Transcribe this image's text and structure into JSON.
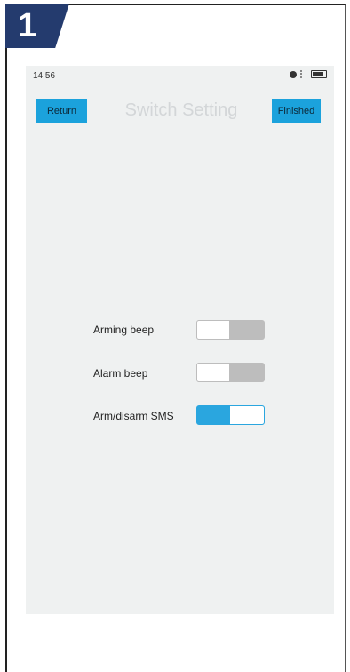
{
  "step": {
    "number": "1"
  },
  "status_bar": {
    "time": "14:56"
  },
  "header": {
    "title": "Switch Setting",
    "return_label": "Return",
    "finished_label": "Finished"
  },
  "settings": [
    {
      "label": "Arming beep",
      "state": "off"
    },
    {
      "label": "Alarm beep",
      "state": "off"
    },
    {
      "label": "Arm/disarm SMS",
      "state": "on"
    }
  ],
  "colors": {
    "accent": "#1ba2dc",
    "badge": "#243b6e",
    "screen_bg": "#eff1f1"
  }
}
